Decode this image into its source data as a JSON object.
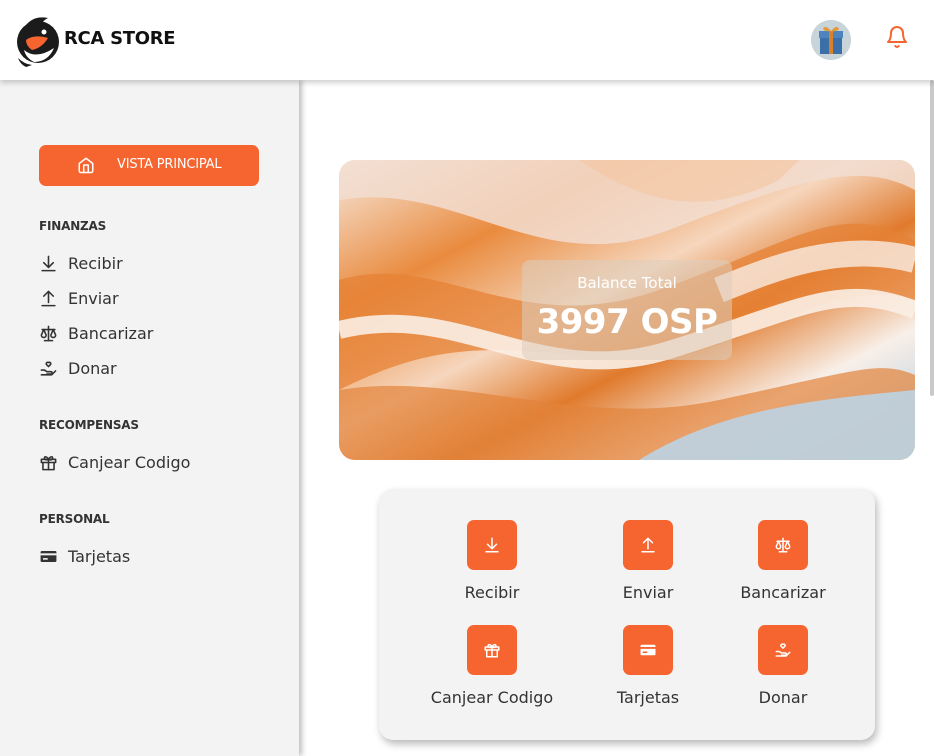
{
  "header": {
    "brand": "RCA STORE",
    "avatar_icon": "gift-avatar",
    "bell_icon": "bell-icon",
    "accent": "#f6652f"
  },
  "sidebar": {
    "main_button": {
      "label": "VISTA PRINCIPAL",
      "icon": "home-icon"
    },
    "sections": [
      {
        "title": "FINANZAS",
        "items": [
          {
            "label": "Recibir",
            "icon": "download-icon"
          },
          {
            "label": "Enviar",
            "icon": "upload-icon"
          },
          {
            "label": "Bancarizar",
            "icon": "scale-icon"
          },
          {
            "label": "Donar",
            "icon": "hand-heart-icon"
          }
        ]
      },
      {
        "title": "RECOMPENSAS",
        "items": [
          {
            "label": "Canjear Codigo",
            "icon": "gift-icon"
          }
        ]
      },
      {
        "title": "PERSONAL",
        "items": [
          {
            "label": "Tarjetas",
            "icon": "credit-card-icon"
          }
        ]
      }
    ]
  },
  "balance": {
    "label": "Balance Total",
    "value": "3997 OSP"
  },
  "actions": [
    {
      "label": "Recibir",
      "icon": "download-icon"
    },
    {
      "label": "Enviar",
      "icon": "upload-icon"
    },
    {
      "label": "Bancarizar",
      "icon": "scale-icon"
    },
    {
      "label": "Canjear Codigo",
      "icon": "gift-icon"
    },
    {
      "label": "Tarjetas",
      "icon": "credit-card-icon"
    },
    {
      "label": "Donar",
      "icon": "hand-heart-icon"
    }
  ]
}
